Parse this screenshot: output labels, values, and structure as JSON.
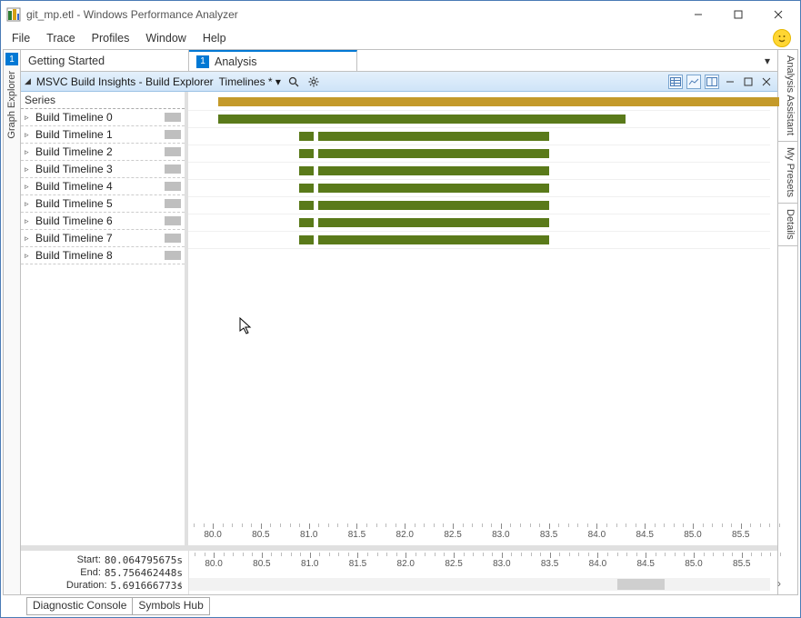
{
  "window": {
    "title": "git_mp.etl - Windows Performance Analyzer"
  },
  "menu": {
    "items": [
      "File",
      "Trace",
      "Profiles",
      "Window",
      "Help"
    ]
  },
  "left_rail": {
    "marker": "1",
    "label": "Graph Explorer"
  },
  "tabs": {
    "items": [
      {
        "num": "",
        "label": "Getting Started",
        "active": false
      },
      {
        "num": "1",
        "label": "Analysis",
        "active": true
      }
    ],
    "drop_glyph": "▾"
  },
  "panel_header": {
    "title": "MSVC Build Insights - Build Explorer",
    "dropdown_label": "Timelines *",
    "dropdown_glyph": "▾"
  },
  "series": {
    "header": "Series",
    "items": [
      {
        "label": "Build Timeline 0"
      },
      {
        "label": "Build Timeline 1"
      },
      {
        "label": "Build Timeline 2"
      },
      {
        "label": "Build Timeline 3"
      },
      {
        "label": "Build Timeline 4"
      },
      {
        "label": "Build Timeline 5"
      },
      {
        "label": "Build Timeline 6"
      },
      {
        "label": "Build Timeline 7"
      },
      {
        "label": "Build Timeline 8"
      }
    ]
  },
  "summary": {
    "start_label": "Start:",
    "start_value": "80.064795675s",
    "end_label": "End:",
    "end_value": "85.756462448s",
    "dur_label": "Duration:",
    "dur_value": "5.691666773s"
  },
  "status": {
    "diag": "Diagnostic Console",
    "sym": "Symbols Hub"
  },
  "right_rail": {
    "tabs": [
      "Analysis Assistant",
      "My Presets",
      "Details"
    ]
  },
  "chart_data": {
    "type": "gantt",
    "title": "MSVC Build Insights - Build Explorer — Timelines",
    "x_unit": "seconds",
    "xlim": [
      79.8,
      85.9
    ],
    "x_ticks": [
      80.0,
      80.5,
      81.0,
      81.5,
      82.0,
      82.5,
      83.0,
      83.5,
      84.0,
      84.5,
      85.0,
      85.5
    ],
    "series": [
      {
        "name": "Build Timeline 0",
        "color": "#c49a2a",
        "segments": [
          {
            "start": 80.06,
            "end": 85.9
          }
        ]
      },
      {
        "name": "Build Timeline 1",
        "color": "#5a7a1a",
        "segments": [
          {
            "start": 80.06,
            "end": 84.3
          }
        ]
      },
      {
        "name": "Build Timeline 2",
        "color": "#5a7a1a",
        "segments": [
          {
            "start": 80.9,
            "end": 81.05
          },
          {
            "start": 81.1,
            "end": 83.5
          }
        ]
      },
      {
        "name": "Build Timeline 3",
        "color": "#5a7a1a",
        "segments": [
          {
            "start": 80.9,
            "end": 81.05
          },
          {
            "start": 81.1,
            "end": 83.5
          }
        ]
      },
      {
        "name": "Build Timeline 4",
        "color": "#5a7a1a",
        "segments": [
          {
            "start": 80.9,
            "end": 81.05
          },
          {
            "start": 81.1,
            "end": 83.5
          }
        ]
      },
      {
        "name": "Build Timeline 5",
        "color": "#5a7a1a",
        "segments": [
          {
            "start": 80.9,
            "end": 81.05
          },
          {
            "start": 81.1,
            "end": 83.5
          }
        ]
      },
      {
        "name": "Build Timeline 6",
        "color": "#5a7a1a",
        "segments": [
          {
            "start": 80.9,
            "end": 81.05
          },
          {
            "start": 81.1,
            "end": 83.5
          }
        ]
      },
      {
        "name": "Build Timeline 7",
        "color": "#5a7a1a",
        "segments": [
          {
            "start": 80.9,
            "end": 81.05
          },
          {
            "start": 81.1,
            "end": 83.5
          }
        ]
      },
      {
        "name": "Build Timeline 8",
        "color": "#5a7a1a",
        "segments": [
          {
            "start": 80.9,
            "end": 81.05
          },
          {
            "start": 81.1,
            "end": 83.5
          }
        ]
      }
    ],
    "summary_range": {
      "start": 80.064795675,
      "end": 85.756462448,
      "duration": 5.691666773
    },
    "scroll_thumb": {
      "start": 84.2,
      "end": 84.7
    }
  }
}
